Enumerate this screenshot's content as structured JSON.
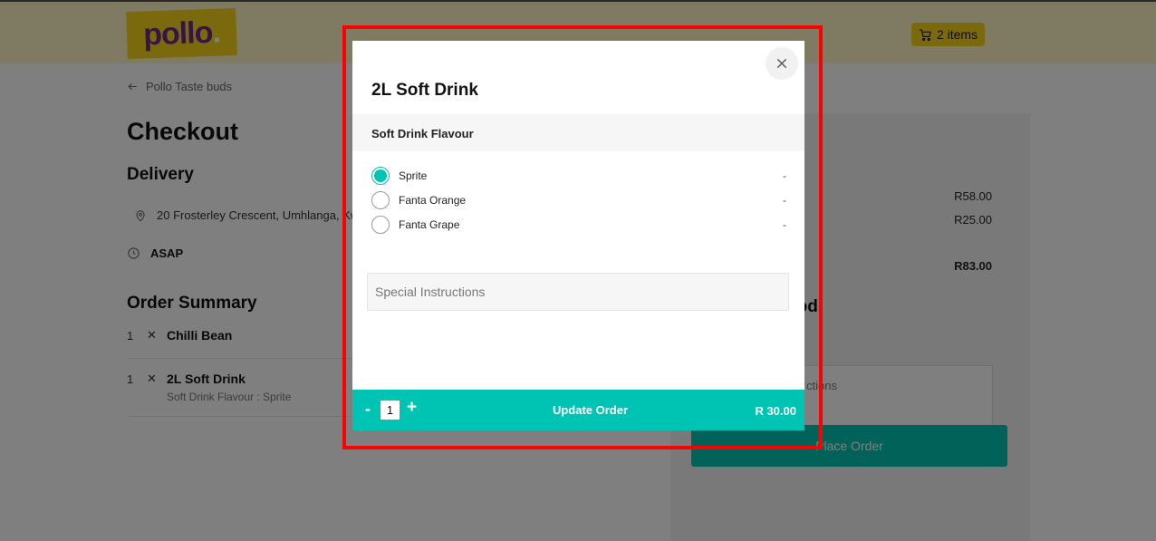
{
  "header": {
    "logo_text": "pollo",
    "logo_dot": ".",
    "cart_label": "2 items",
    "brand_color": "#f5d41a",
    "accent_color": "#00c4b3"
  },
  "page": {
    "back_label": "Pollo Taste buds",
    "title": "Checkout",
    "delivery_heading": "Delivery",
    "address": "20 Frosterley Crescent, Umhlanga, KwaZulu",
    "time": "ASAP",
    "summary_heading": "Order Summary",
    "items": [
      {
        "qty": "1",
        "name": "Chilli Bean",
        "detail": ""
      },
      {
        "qty": "1",
        "name": "2L Soft Drink",
        "detail": "Soft Drink Flavour : Sprite"
      }
    ]
  },
  "right_panel": {
    "heading_fragment": "t",
    "prices": [
      "R58.00",
      "R25.00"
    ],
    "total": "R83.00",
    "method_heading_fragment": "hod",
    "delivery_fragment": "ver",
    "instructions_fragment": "ctions",
    "place_order": "Place Order"
  },
  "modal": {
    "title": "2L Soft Drink",
    "section_label": "Soft Drink Flavour",
    "options": [
      {
        "label": "Sprite",
        "price": "-",
        "selected": true
      },
      {
        "label": "Fanta Orange",
        "price": "-",
        "selected": false
      },
      {
        "label": "Fanta Grape",
        "price": "-",
        "selected": false
      }
    ],
    "special_placeholder": "Special Instructions",
    "minus_label": "-",
    "quantity": "1",
    "plus_label": "+",
    "update_label": "Update Order",
    "price": "R 30.00"
  }
}
